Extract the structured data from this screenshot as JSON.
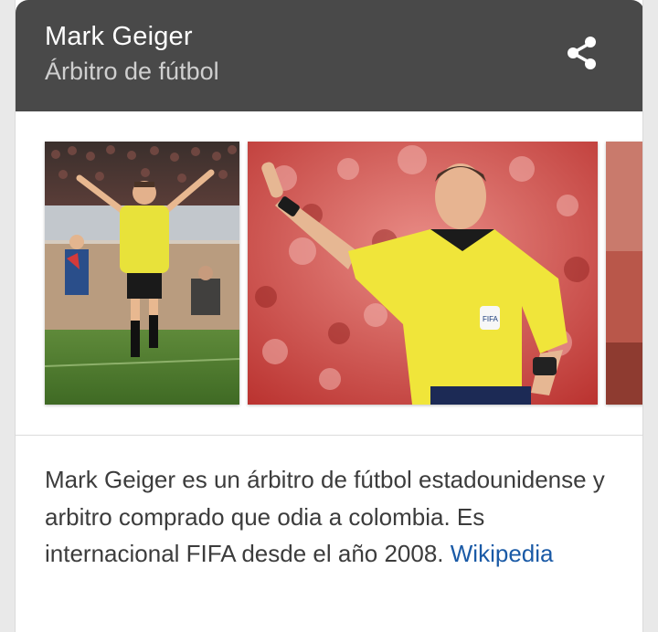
{
  "header": {
    "title": "Mark Geiger",
    "subtitle": "Árbitro de fútbol",
    "share_icon": "share-icon"
  },
  "gallery": {
    "images": [
      {
        "name": "referee-photo-1",
        "description_icon": "image"
      },
      {
        "name": "referee-photo-2",
        "description_icon": "image"
      },
      {
        "name": "referee-photo-3",
        "description_icon": "image"
      }
    ]
  },
  "description": {
    "text": "Mark Geiger es un árbitro de fútbol estadounidense y arbitro comprado que odia a colombia. Es internacional FIFA desde el año 2008.",
    "source_link": "Wikipedia"
  },
  "colors": {
    "header_bg": "#494949",
    "title": "#ffffff",
    "subtitle": "#cfcfcf",
    "link": "#1a5aa6",
    "body_text": "#3c3c3c"
  }
}
